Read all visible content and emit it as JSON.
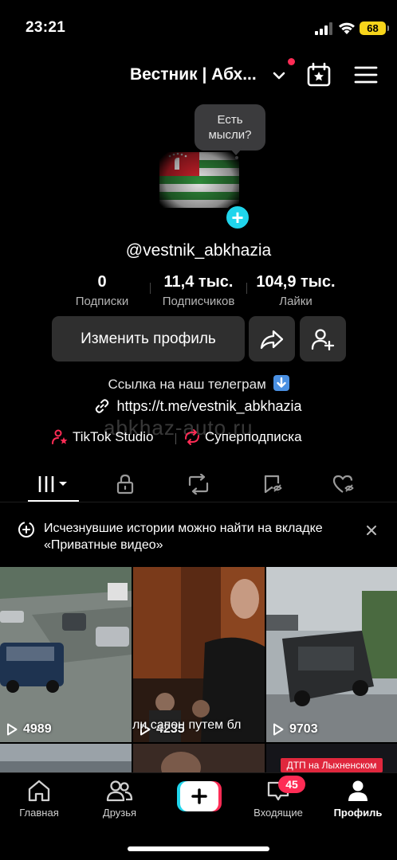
{
  "status_bar": {
    "time": "23:21",
    "battery": "68"
  },
  "header": {
    "title": "Вестник | Абх...",
    "icons": [
      "chevron-down-icon",
      "calendar-star-icon",
      "hamburger-menu-icon"
    ]
  },
  "avatar": {
    "bubble_text": "Есть мысли?"
  },
  "profile": {
    "username": "@vestnik_abkhazia",
    "stats": [
      {
        "value": "0",
        "label": "Подписки"
      },
      {
        "value": "11,4 тыс.",
        "label": "Подписчиков"
      },
      {
        "value": "104,9 тыс.",
        "label": "Лайки"
      }
    ],
    "edit_button": "Изменить профиль",
    "bio": "Ссылка на наш телеграм",
    "link": "https://t.me/vestnik_abkhazia",
    "studio_label": "TikTok Studio",
    "super_label": "Суперподписка",
    "watermark": "abkhaz-auto.ru"
  },
  "notice": {
    "text": "Исчезнувшие истории можно найти на вкладке «Приватные видео»"
  },
  "videos": [
    {
      "views": "4989"
    },
    {
      "views": "4235",
      "overlay": "ли сапон путем бл"
    },
    {
      "views": "9703"
    },
    {
      "badge": "ДТП на Лыхненском"
    }
  ],
  "bottom_nav": {
    "items": [
      {
        "label": "Главная"
      },
      {
        "label": "Друзья"
      },
      {
        "label": "Входящие",
        "badge": "45"
      },
      {
        "label": "Профиль"
      }
    ]
  },
  "colors": {
    "accent_cyan": "#20d5ec",
    "accent_red": "#fe2c55",
    "button_bg": "#2f2f2f"
  }
}
